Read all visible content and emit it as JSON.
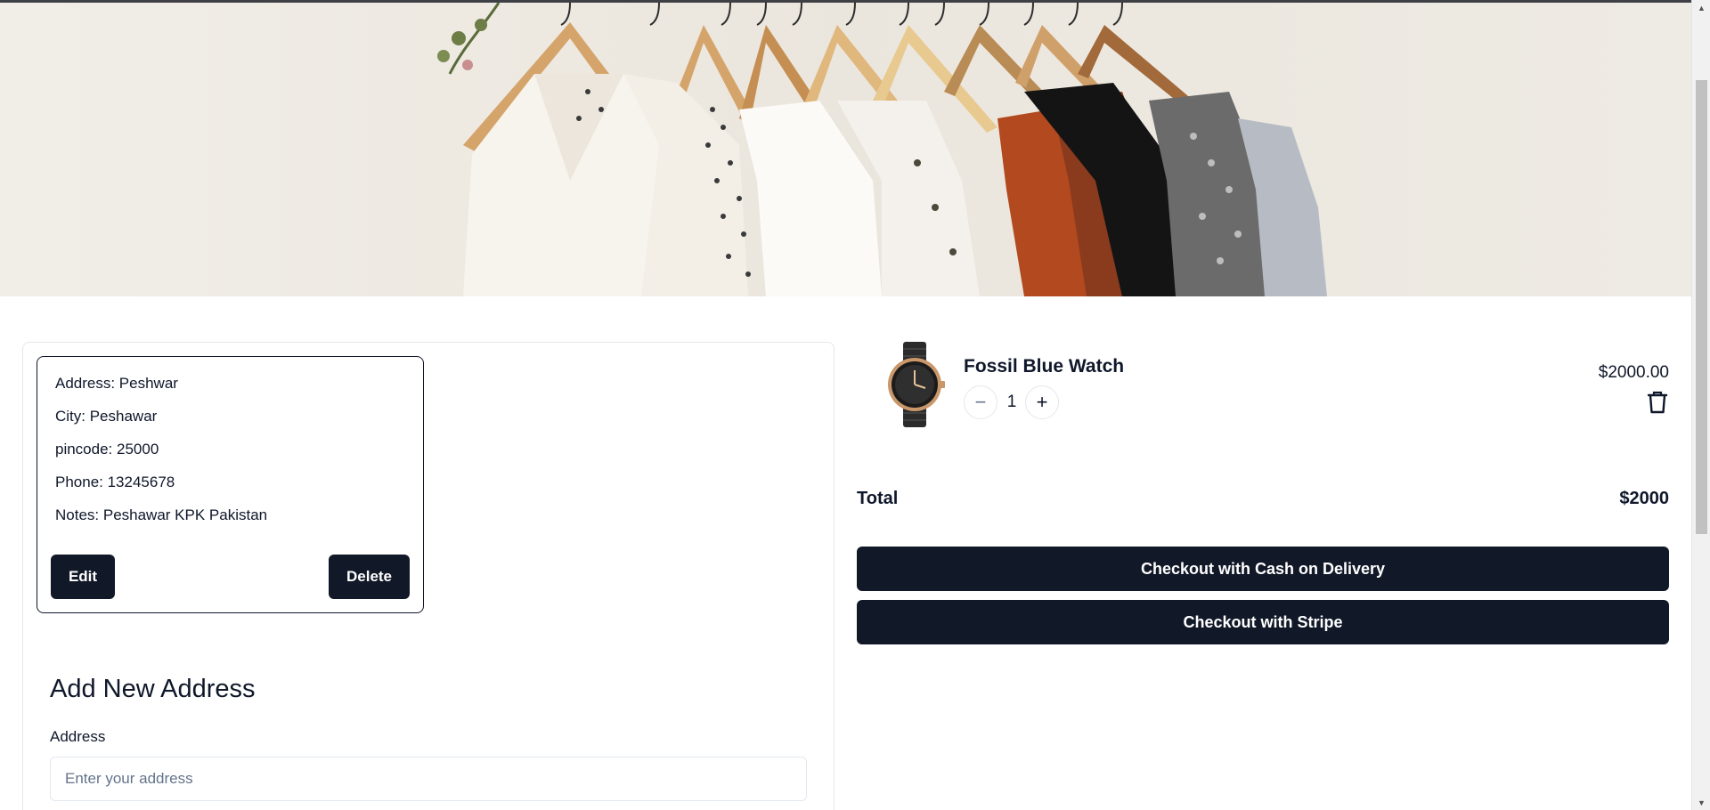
{
  "address_card": {
    "address": "Address: Peshwar",
    "city": "City: Peshawar",
    "pincode": "pincode: 25000",
    "phone": "Phone: 13245678",
    "notes": "Notes: Peshawar KPK Pakistan",
    "edit_label": "Edit",
    "delete_label": "Delete"
  },
  "add_address": {
    "title": "Add New Address",
    "address_label": "Address",
    "address_placeholder": "Enter your address",
    "address_value": ""
  },
  "cart": {
    "item": {
      "name": "Fossil Blue Watch",
      "quantity": "1",
      "price": "$2000.00",
      "minus_icon": "minus-icon",
      "plus_icon": "plus-icon",
      "delete_icon": "trash-icon"
    },
    "total_label": "Total",
    "total_value": "$2000",
    "checkout_cod_label": "Checkout with Cash on Delivery",
    "checkout_stripe_label": "Checkout with Stripe"
  },
  "colors": {
    "primary_button": "#111827",
    "text": "#0f172a",
    "border": "#e5e7eb"
  }
}
